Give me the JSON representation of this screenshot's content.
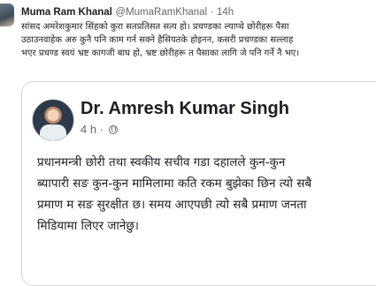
{
  "tweet": {
    "author_name": "Muma Ram Khanal",
    "author_handle": "@MumaRamKhanal",
    "separator": "·",
    "timestamp": "14h",
    "text_lines": [
      "सांसद अमरेशकुमार सिंहको कुरा सतप्रतिसत सत्य हो। प्रचण्डका ल्याप्चे छोरीहरू पैसा",
      "उठाउनवाहेक अरु कुनै पनि काम गर्न सक्ने हैसियतके होइनन, कसरी प्रचण्डका सल्लाह",
      "भएर प्रचण्ड स्वयं भ्रष्ट कागजी बाघ हो, भ्रष्ट छोरीहरू त पैसाका लागि जे पनि गर्ने नै भए।"
    ]
  },
  "embedded_post": {
    "author_name": "Dr. Amresh Kumar Singh",
    "timestamp": "4 h ·",
    "audience_icon": "globe-icon",
    "body_lines": [
      "प्रधानमन्त्री छोरी तथा स्वकीय सचीव गडा दहालले कुन-कुन",
      "ब्यापारी सङ कुन-कुन मामिलामा कति रकम बुझेका छिन त्यो सबै",
      "प्रमाण म सङ सुरक्षीत छ। समय आएपछी त्यो सबै प्रमाण जनता",
      "मिडियामा लिएर जानेछु।"
    ]
  }
}
